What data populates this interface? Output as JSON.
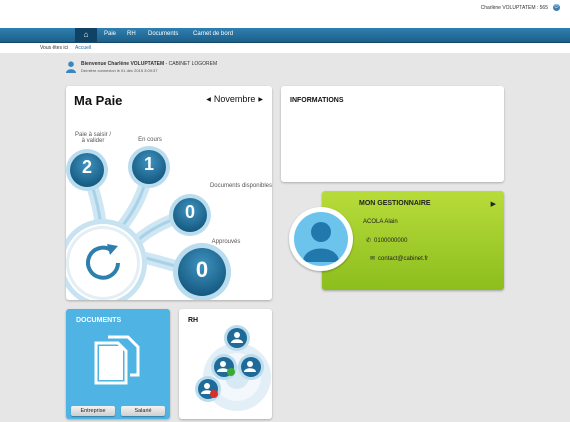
{
  "user": {
    "label": "Charlène VOLUPTATEM : 565"
  },
  "nav": {
    "items": [
      "Paie",
      "RH",
      "Documents",
      "Carnet de bord"
    ]
  },
  "breadcrumb": {
    "label": "Vous êtes ici",
    "current": "Accueil"
  },
  "welcome": {
    "prefix": "Bienvenue Charlène VOLUPTATEM",
    "company": " - CABINET LOGOREM",
    "last_login": "Dernière connexion le 01 déc 2015 3:09:37"
  },
  "paie": {
    "title": "Ma Paie",
    "month": "Novembre",
    "a_saisir_label_1": "Paie à saisir /",
    "a_saisir_label_2": "à valider",
    "a_saisir_count": "2",
    "en_cours_label": "En cours",
    "en_cours_count": "1",
    "documents_label": "Documents disponibles",
    "documents_count": "0",
    "approuves_label": "Approuvés",
    "approuves_count": "0"
  },
  "informations": {
    "title": "INFORMATIONS"
  },
  "gestionnaire": {
    "title": "MON GESTIONNAIRE",
    "name": "ACOLA Alain",
    "phone": "0100000000",
    "email": "contact@cabinet.fr"
  },
  "documents": {
    "title": "DOCUMENTS",
    "btn_entreprise": "Entreprise",
    "btn_salarie": "Salarié"
  },
  "rh": {
    "title": "RH"
  },
  "colors": {
    "brand_blue": "#1f6a98",
    "accent_green": "#9ccc2a",
    "doc_blue": "#4fb3e3"
  }
}
